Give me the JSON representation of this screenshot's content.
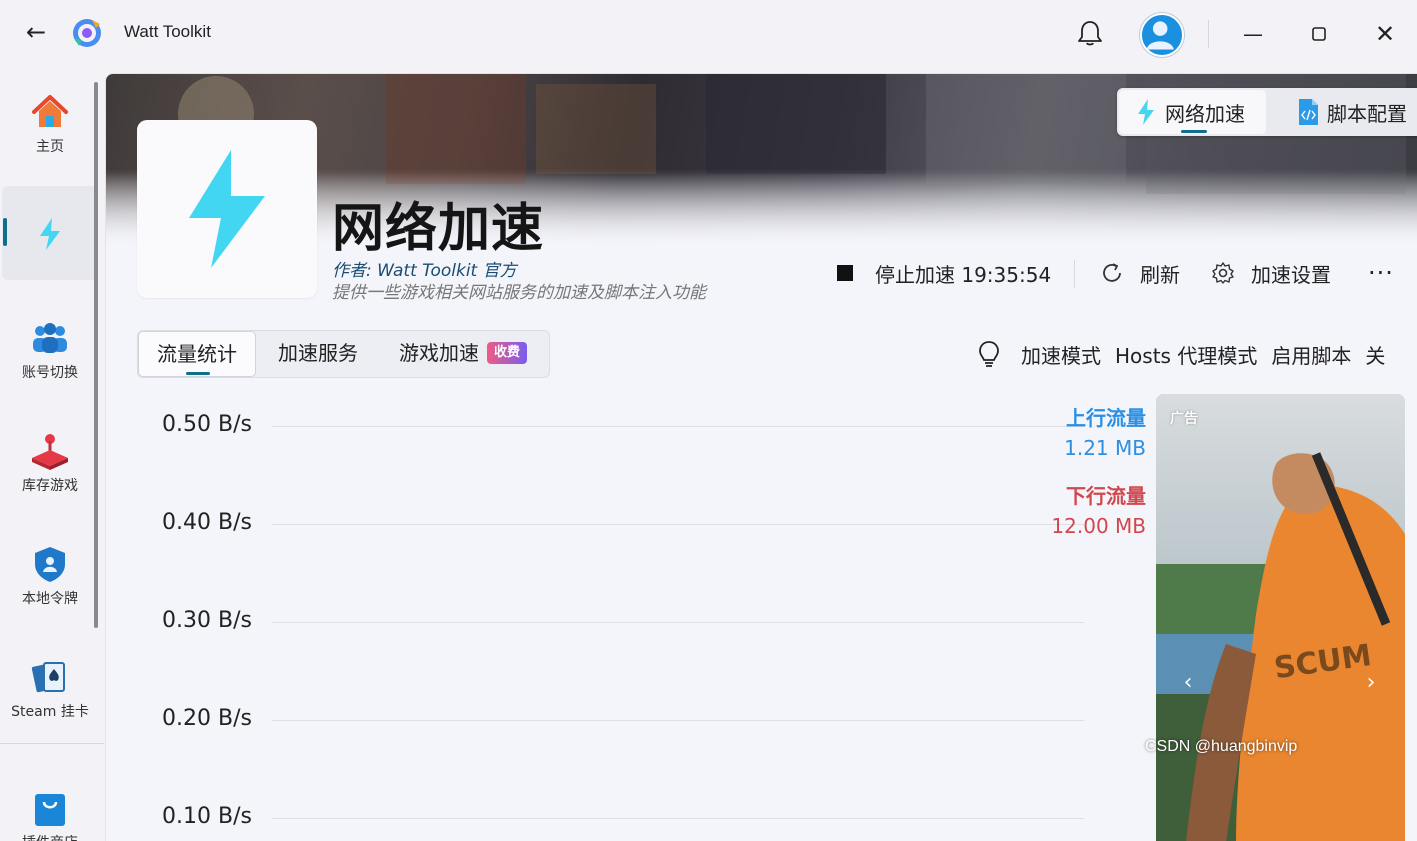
{
  "window": {
    "title": "Watt Toolkit"
  },
  "sidebar": {
    "items": [
      {
        "label": "主页",
        "icon": "home-icon"
      },
      {
        "label": "",
        "icon": "lightning-icon",
        "active": true
      },
      {
        "label": "账号切换",
        "icon": "users-icon"
      },
      {
        "label": "库存游戏",
        "icon": "joystick-icon"
      },
      {
        "label": "本地令牌",
        "icon": "shield-icon"
      },
      {
        "label": "Steam 挂卡",
        "icon": "cards-icon"
      },
      {
        "label": "插件商店",
        "icon": "shopping-bag-icon"
      }
    ]
  },
  "header_switch": {
    "items": [
      {
        "label": "网络加速",
        "icon": "lightning-icon",
        "active": true
      },
      {
        "label": "脚本配置",
        "icon": "script-icon",
        "active": false
      }
    ]
  },
  "plugin": {
    "title": "网络加速",
    "author": "作者:  Watt Toolkit  官方",
    "description": "提供一些游戏相关网站服务的加速及脚本注入功能"
  },
  "actions": {
    "stop_label": "停止加速 19:35:54",
    "refresh_label": "刷新",
    "settings_label": "加速设置",
    "more_label": "···"
  },
  "tabs": {
    "items": [
      "流量统计",
      "加速服务",
      "游戏加速"
    ],
    "badge": "收费"
  },
  "mode": {
    "items": [
      "加速模式",
      "Hosts 代理模式",
      "启用脚本",
      "关"
    ]
  },
  "chart_data": {
    "type": "line",
    "title": "",
    "ylabel": "",
    "xlabel": "",
    "y_ticks": [
      "0.50 B/s",
      "0.40 B/s",
      "0.30 B/s",
      "0.20 B/s",
      "0.10 B/s"
    ],
    "ylim": [
      0.1,
      0.5
    ],
    "series": [
      {
        "name": "上行流量",
        "total": "1.21 MB",
        "color": "#2b8fe4",
        "values": []
      },
      {
        "name": "下行流量",
        "total": "12.00 MB",
        "color": "#d0484e",
        "values": []
      }
    ]
  },
  "ad": {
    "tag": "广告",
    "prev": "‹",
    "next": "›"
  },
  "watermark": "CSDN @huangbinvip",
  "colors": {
    "accent": "#0f6f8a",
    "lightning": "#43d6f2",
    "upload": "#2b8fe4",
    "download": "#d0484e"
  }
}
